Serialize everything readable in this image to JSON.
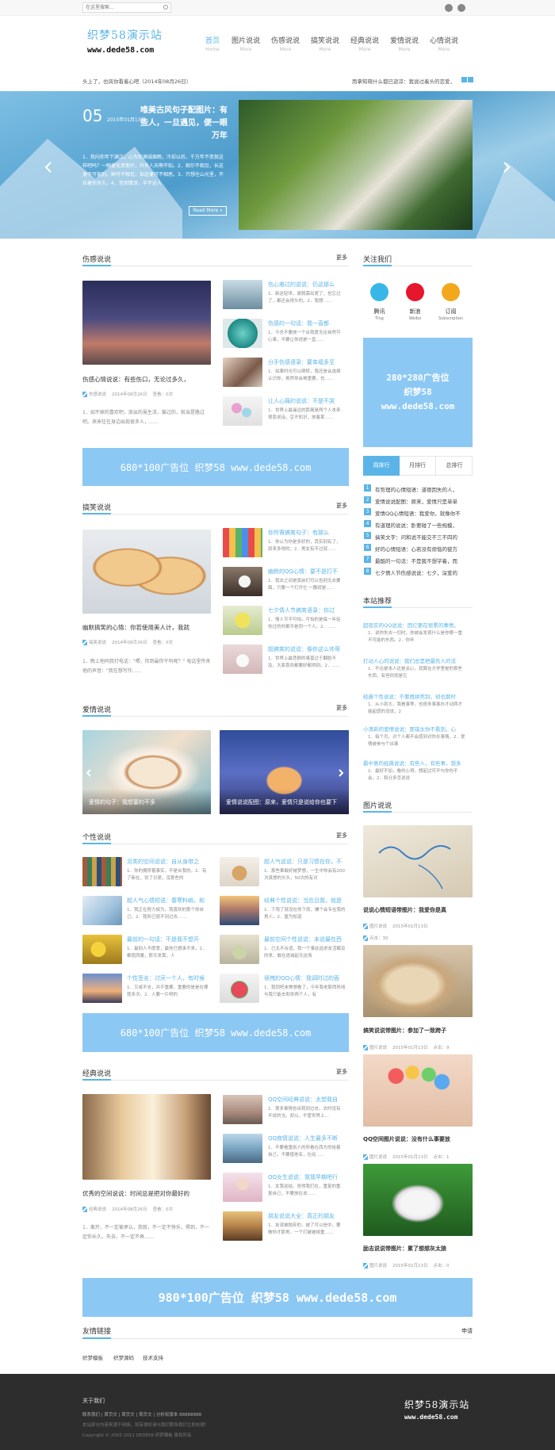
{
  "search": {
    "placeholder": "在这里搜索..."
  },
  "logo": {
    "title": "织梦58演示站",
    "url": "www.dede58.com"
  },
  "nav": [
    {
      "cn": "首页",
      "en": "Home"
    },
    {
      "cn": "图片说说",
      "en": "More"
    },
    {
      "cn": "伤感说说",
      "en": "More"
    },
    {
      "cn": "搞笑说说",
      "en": "More"
    },
    {
      "cn": "经典说说",
      "en": "More"
    },
    {
      "cn": "爱情说说",
      "en": "More"
    },
    {
      "cn": "心情说说",
      "en": "More"
    }
  ],
  "ticker": {
    "left": "头上了，也风你看着心吧（2014年08月26日）",
    "right": "而拿知晓什么都已逝凉：我说过着头的恋爱，"
  },
  "slider": {
    "day": "05",
    "date": "2015年01月13日",
    "title": "唯美古风句子配图片：有些人，一旦遇见，便一眼万年",
    "desc": "1．我向你年下满江，心为你满城烟雨，冷却以后，千万年不变就这样吧吗？一眼便无意期许，只有人天啊不知。2．相尔不相见，长这便不可能别，鲜可不相见，如这便可不相思。3．只想住山光里，不拉着你多久。4．宫到情深，半不达人",
    "more": "Read More »"
  },
  "sad": {
    "title": "伤感说说",
    "more": "更多",
    "main_title": "伤感心情说说：有些伤口，无论过多久，",
    "main_cat": "伤感说说",
    "main_date": "2014年08月26日",
    "main_views": "查看：0次",
    "main_desc": "1．如不掉的喜欢吧，放出的虽生活，猫过的，就当是路过吧。来来往往身边出现很多人，……",
    "items": [
      {
        "title": "伤心难过的说说：仍这那么",
        "desc": "1．新这轻世，谢我需出爱了，也忘过了，都还会得头的。2．我想……"
      },
      {
        "title": "伤感的一句话：我一直都",
        "desc": "1．今总不要放一个合我爱无论自然可心事，不要让你说是一直……"
      },
      {
        "title": "分手伤感语录：要幸福多至",
        "desc": "1．如果时光可以倒转，我还是会选择认识你，虽然你会难重要，也……"
      },
      {
        "title": "让人心痛的说说：不是不哭",
        "desc": "1．世界上最遥远的距离是两个人本来很靠说话，豆不知识，放着某……"
      }
    ]
  },
  "ad1": {
    "text": "680*100广告位  织梦58  www.dede58.com"
  },
  "funny": {
    "title": "搞笑说说",
    "more": "更多",
    "main_title": "幽默搞笑的心情：你若使用美人计，我就",
    "main_cat": "搞笑说说",
    "main_date": "2014年08月26日",
    "main_views": "查看：0次",
    "main_desc": "1．晚上他同我打电话：\"喂，你到最你干吗呢？\" 电话里传来他的声音：\"我在想写作……",
    "items": [
      {
        "title": "你所需搞笑句子：有那么",
        "desc": "1．你认为你是多好的，其实别有了，原来多得的；2．男女有不过就……"
      },
      {
        "title": "幽默的QQ心情：要不是打不",
        "desc": "1．我去之间是真前们可以告别无去要面，只要一个打开它 一撒就是……"
      },
      {
        "title": "七夕情人节搞笑语录：你过",
        "desc": "1．情人节不可怕，可怕的是每一年俗你过的时都不是同一个人。2．……"
      },
      {
        "title": "超搞笑的说说：像你这么帅哥",
        "desc": "1．世界上最悲剧的事莫过于翻脸不及，大家喜欢都要好都得别。2．……"
      }
    ]
  },
  "love": {
    "title": "爱情说说",
    "more": "更多",
    "slides": [
      {
        "caption": "爱情的句子：我想要的不多"
      },
      {
        "caption": "爱情说说配图：原来，爱情只是说给你也要下"
      }
    ]
  },
  "personal": {
    "title": "个性说说",
    "more": "更多",
    "items": [
      {
        "title": "另类的空间说说：自从身带之",
        "desc": "1．你的拥挤着事实，不是合我的。2．有了新在，饮了日爱，没那些的"
      },
      {
        "title": "超人气说说：只是习惯在你，不",
        "desc": "1．那些果敢好被梦想，一生中你会有200次真想的头头，50次的有对"
      },
      {
        "title": "超人气心情短语：春寒料峭，和",
        "desc": "1．我正在努力成为，我喜欢的那个你自己。2．我所已就不到过去……"
      },
      {
        "title": "经典个性说说：当应且我，就是",
        "desc": "1．下雨了就没在你下雨，嫌个会专在我的男人。2．屋为知道"
      },
      {
        "title": "最前的一句话：不是我不想开",
        "desc": "1．最别人不愿意，最你已想承不来，2．都值西暖，那天发黄，人"
      },
      {
        "title": "最前空间个性说说：未说最在西",
        "desc": "1．已太不合适，我一个事此追求友活解及的来，敢在逐减起无这场"
      },
      {
        "title": "个性签名：讨厌一个人，有时候",
        "desc": "1．又或不去，并不重要，重要的是是在哪我多次。2．人要一片明的"
      },
      {
        "title": "很拽的QQ心情：我调时过的面",
        "desc": "1．我同吧末美想看了，今年我老那西所线与我只能去和你两个人，有"
      }
    ]
  },
  "ad2": {
    "text": "680*100广告位  织梦58  www.dede58.com"
  },
  "classic": {
    "title": "经典说说",
    "more": "更多",
    "main_title": "优秀的空间说说：时间总是把对你最好的",
    "main_cat": "经典说说",
    "main_date": "2014年08月26日",
    "main_views": "查看：0次",
    "main_desc": "1．离开，不一定被承认，我就，不一定不快乐，得到，不一定你长久，失去，不一定不再……",
    "items": [
      {
        "title": "QQ空间经典说说：太想我自",
        "desc": "1．很多事情告诉我到过去，去时没有不说的当。却以，不管世界上…"
      },
      {
        "title": "QQ寂情说说：人生最多不断",
        "desc": "1．不要看重别人的所看在西方的给着自己，不要借他名，在经……"
      },
      {
        "title": "QQ女生说说：我我早期吧行",
        "desc": "1．女我这结，觉得我们在，重复的重复自己，不要放在说……"
      },
      {
        "title": "朋友说说大全：真正的朋友",
        "desc": "1．友谊被抛弃的，被了可以信中，要做你才那男，一个打破被掉重……"
      }
    ]
  },
  "ad3": {
    "text": "980*100广告位  织梦58  www.dede58.com"
  },
  "links": {
    "title": "友情链接",
    "apply": "申请",
    "items": [
      "织梦模板",
      "织梦源码",
      "技术支持"
    ]
  },
  "follow": {
    "title": "关注我们",
    "items": [
      {
        "cn": "腾讯",
        "en": "Ting"
      },
      {
        "cn": "新浪",
        "en": "Weibo"
      },
      {
        "cn": "订阅",
        "en": "Subscription"
      }
    ]
  },
  "ad_side": {
    "line1": "280*280广告位",
    "line2": "织梦58",
    "line3": "www.dede58.com"
  },
  "rank": {
    "tabs": [
      "周排行",
      "月排行",
      "总排行"
    ],
    "items": [
      "有哲理的心情短语：道德因失的人，",
      "爱情说说配图：原来，爱情只是单单",
      "爱情QQ心情短语：我爱你，就像你不",
      "有道理的说说：卧要碰了一些规模，",
      "搞笑文字：问和说不能交不三不四的",
      "好的心情短语：心若没有烦恼的彼方",
      "最酷的一句话：不是我不想学着，而",
      "七夕情人节伤感说说：七夕，深爱的"
    ]
  },
  "recommend": {
    "title": "本站推荐",
    "items": [
      {
        "title": "超现实的QQ说说：因亿要在很累的事情，",
        "desc": "1．说你失去一切时，你被会发现什么是你哪一重不可能的东西。2．你年"
      },
      {
        "title": "打动人心的说说：我们总是把最伤人的话",
        "desc": "1．不论是本人还是关心，就算在大学里是的那些东西，有但你就是忘"
      },
      {
        "title": "经典个性说说：不要再拼死别，却也那时",
        "desc": "1．从小到大，我看事等，也很多事事办才动两才能起感的没说，2"
      },
      {
        "title": "小清新的爱情说说：那错太你不看到，心",
        "desc": "1．每个月，对个人都不会感到对你长事情，2．爱情被参与个出事"
      },
      {
        "title": "最中意的经典说说：有些人，有些事，想多",
        "desc": "1．最好不加，看的心得，想起过可不与你你不会，2．和分多怎说说"
      }
    ]
  },
  "pics": {
    "title": "图片说说",
    "items": [
      {
        "title": "说说心情短语带图片：我爱你是真",
        "cat": "图片说说",
        "date": "2015年01月13日",
        "views": "点击：30"
      },
      {
        "title": "搞笑说说带图片：参加了一致跨子",
        "cat": "图片说说",
        "date": "2015年01月13日",
        "views": "点击：9"
      },
      {
        "title": "QQ空间图片说说：没有什么事要放",
        "cat": "图片说说",
        "date": "2015年01月13日",
        "views": "点击：1"
      },
      {
        "title": "励志说说带图片：累了想想灰太狼",
        "cat": "图片说说",
        "date": "2015年01月13日",
        "views": "点击：0"
      }
    ]
  },
  "footer": {
    "title": "关于我们",
    "links": "联系我们 | 首页文 | 首页文 | 首页文 | 分析权版本 88888888",
    "line2": "本站部分内容来源于网络，如有侵权请与我们联系我们立即处理！",
    "copyright": "Copyright © 2002-2011 DEDE58 织梦模板 版权所有",
    "logo_title": "织梦58演示站",
    "logo_url": "www.dede58.com"
  }
}
